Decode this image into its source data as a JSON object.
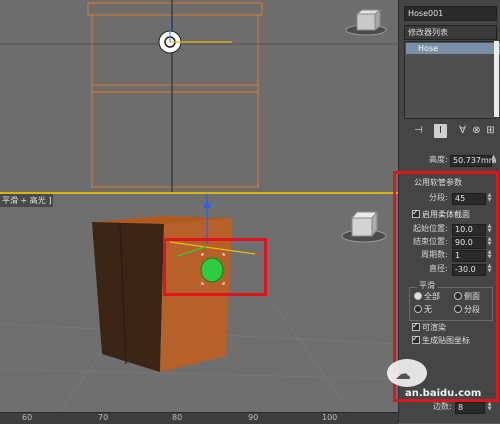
{
  "viewport_label": "平滑 + 高光 ]",
  "object_name": "Hose001",
  "modifier_list": "修改器列表",
  "stack_items": [
    "Hose"
  ],
  "height": {
    "label": "高度:",
    "value": "50.737mm"
  },
  "rollout_title": "公用软管参数",
  "segments": {
    "label": "分段:",
    "value": "45"
  },
  "flex": {
    "enable_label": "启用柔体截面",
    "start_label": "起始位置:",
    "start_value": "10.0",
    "end_label": "结束位置:",
    "end_value": "90.0",
    "cycles_label": "周期数:",
    "cycles_value": "1",
    "diameter_label": "直径:",
    "diameter_value": "-30.0"
  },
  "smooth": {
    "title": "平滑",
    "all": "全部",
    "sides": "侧面",
    "none": "无",
    "segments": "分段"
  },
  "renderable": "可渲染",
  "gen_mapping": "生成贴图坐标",
  "sides_label": "边数:",
  "sides_value": "8",
  "ruler_ticks": [
    "60",
    "70",
    "80",
    "90",
    "100"
  ],
  "watermark": "an.baidu.com",
  "colors": {
    "selection_red": "#e1141e",
    "viewport_border": "#d8b400",
    "hose_green": "#2ecc40"
  }
}
